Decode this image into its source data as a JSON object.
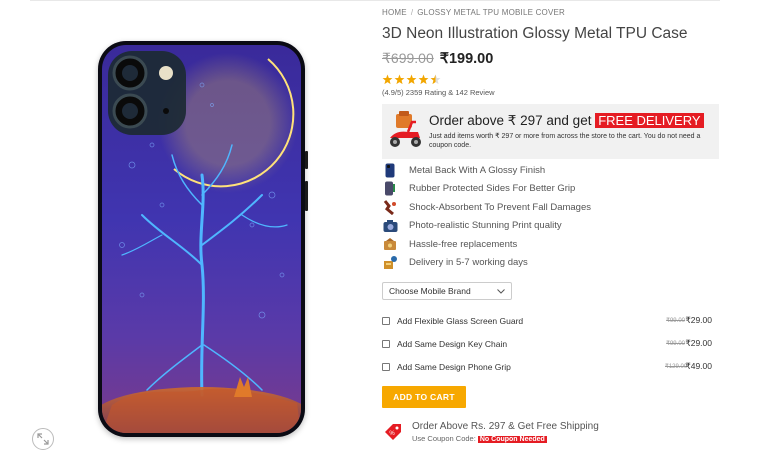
{
  "breadcrumb": {
    "home": "HOME",
    "separator": "/",
    "category": "GLOSSY METAL TPU MOBILE COVER"
  },
  "product": {
    "title": "3D Neon Illustration Glossy Metal TPU Case",
    "price_old": "₹699.00",
    "price_new": "₹199.00",
    "rating_stars": 4.5,
    "rating_text": "(4.9/5) 2359 Rating & 142 Review"
  },
  "delivery_banner": {
    "headline": "Order above ₹ 297 and get ",
    "highlight": "FREE DELIVERY",
    "subtext": "Just add items worth ₹ 297 or more from across the store to the cart. You do not need a coupon code.",
    "icon": "scooter-icon"
  },
  "features": [
    {
      "icon": "phone-case-icon",
      "text": "Metal Back With A Glossy Finish"
    },
    {
      "icon": "rubber-sides-icon",
      "text": "Rubber Protected Sides For Better Grip"
    },
    {
      "icon": "shock-absorbent-icon",
      "text": "Shock-Absorbent To Prevent Fall Damages"
    },
    {
      "icon": "camera-print-icon",
      "text": "Photo-realistic Stunning Print quality"
    },
    {
      "icon": "replacement-icon",
      "text": "Hassle-free replacements"
    },
    {
      "icon": "delivery-box-icon",
      "text": "Delivery in 5-7 working days"
    }
  ],
  "brand_select": {
    "label": "Choose Mobile Brand"
  },
  "addons": [
    {
      "label": "Add Flexible Glass Screen Guard",
      "old": "₹99.00",
      "new": "₹29.00"
    },
    {
      "label": "Add Same Design Key Chain",
      "old": "₹99.00",
      "new": "₹29.00"
    },
    {
      "label": "Add Same Design Phone Grip",
      "old": "₹129.00",
      "new": "₹49.00"
    }
  ],
  "cart": {
    "label": "ADD TO CART"
  },
  "shipping": {
    "title": "Order Above Rs. 297 & Get Free Shipping",
    "coupon_prefix": "Use Coupon Code: ",
    "coupon_tag": "No Coupon Needed"
  },
  "colors": {
    "accent": "#f7a800",
    "highlight_red": "#e51c23"
  }
}
